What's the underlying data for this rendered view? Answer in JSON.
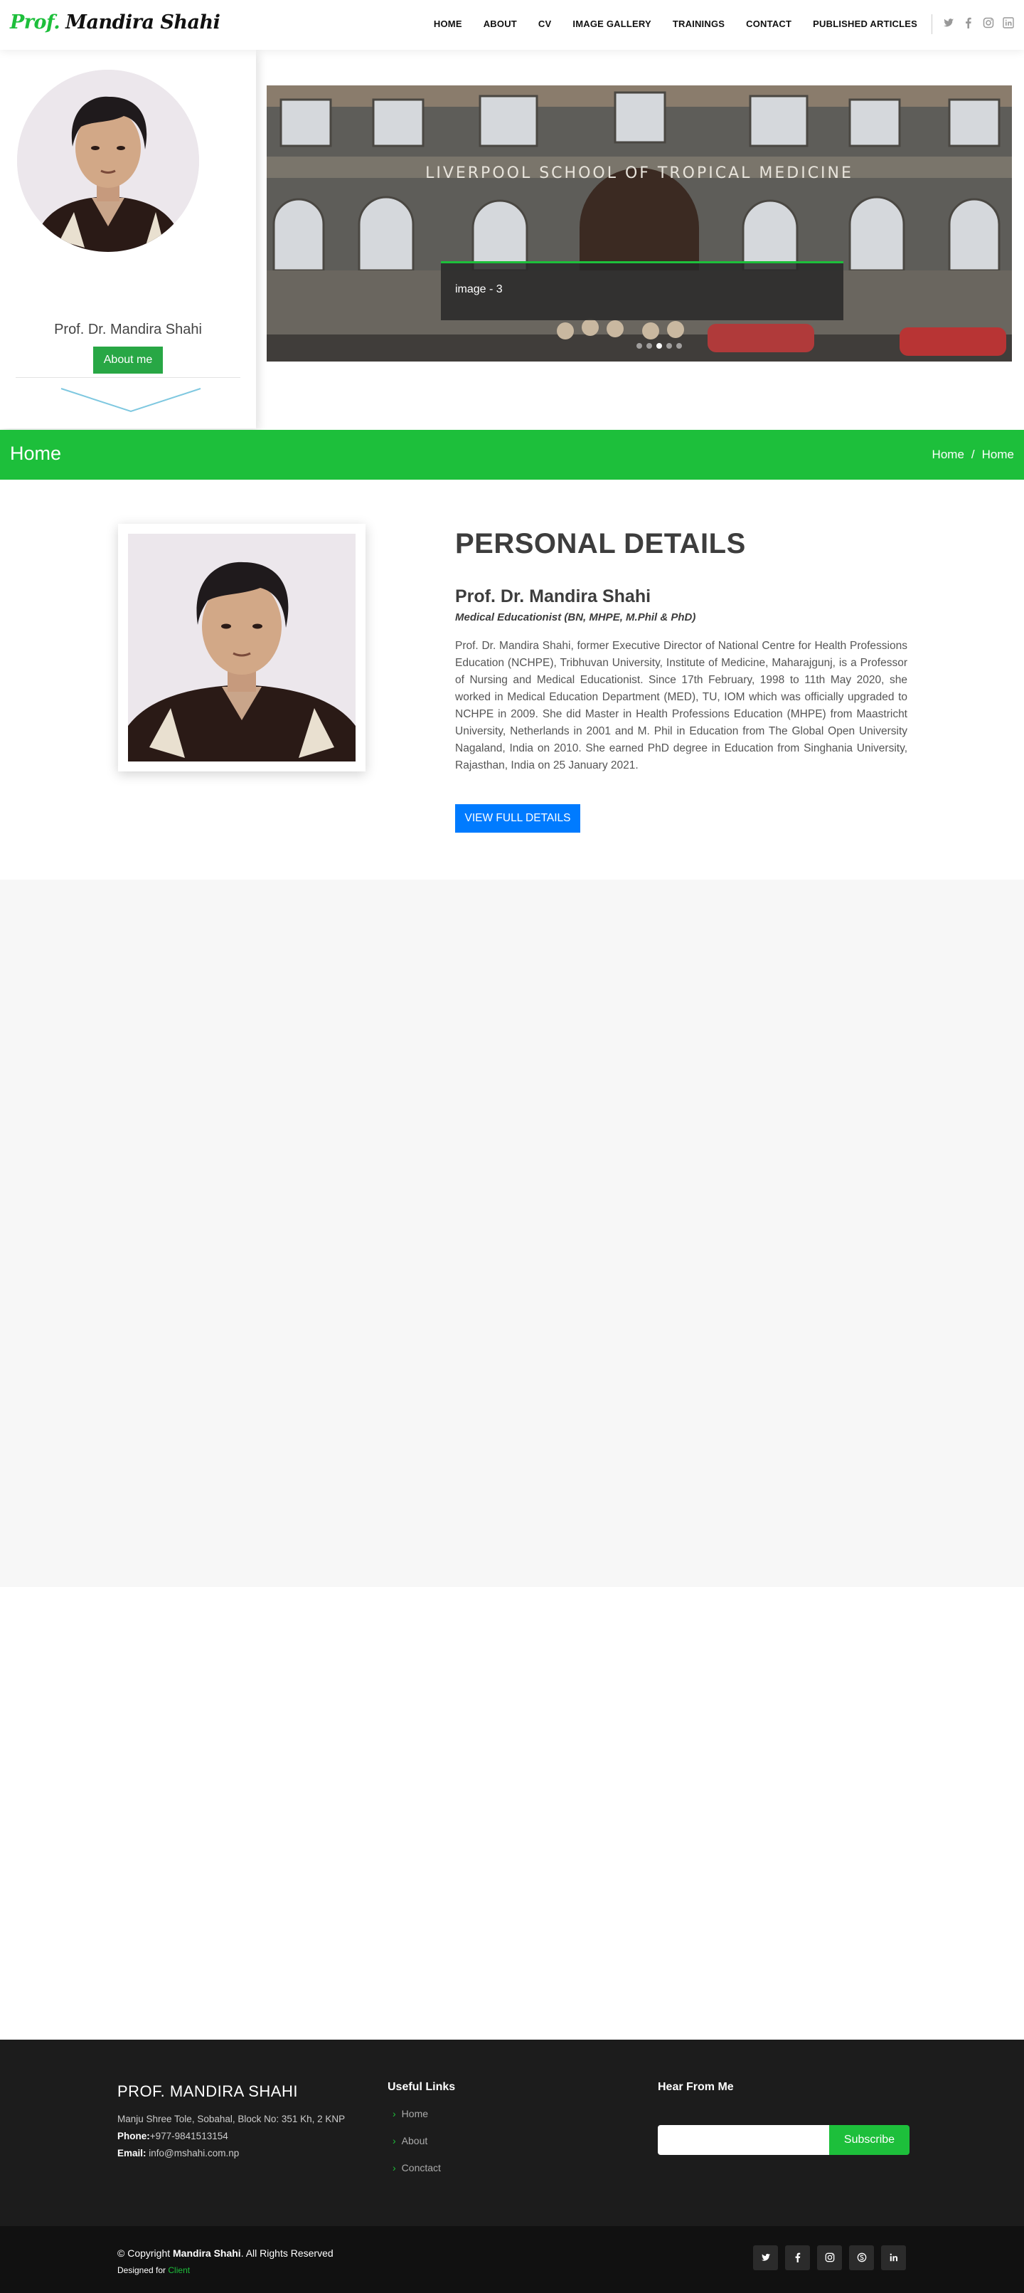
{
  "header": {
    "logo_prefix": "Prof.",
    "logo_name": "Mandira Shahi",
    "nav": [
      "HOME",
      "ABOUT",
      "CV",
      "IMAGE GALLERY",
      "TRAININGS",
      "CONTACT",
      "PUBLISHED ARTICLES"
    ],
    "social_icons": [
      "twitter-icon",
      "facebook-icon",
      "instagram-icon",
      "linkedin-icon"
    ]
  },
  "profile": {
    "name": "Prof. Dr. Mandira Shahi",
    "about_button": "About me"
  },
  "slider": {
    "building_sign": "LIVERPOOL   SCHOOL   OF          TROPICAL   MEDICINE",
    "caption": "image - 3",
    "slides_count": 5,
    "active_slide": 3
  },
  "page_bar": {
    "title": "Home",
    "breadcrumb": [
      "Home",
      "Home"
    ],
    "separator": "/",
    "color": "#1dbf3b"
  },
  "personal": {
    "heading": "PERSONAL DETAILS",
    "name": "Prof. Dr. Mandira Shahi",
    "role": "Medical  Educationist (BN, MHPE, M.Phil & PhD)",
    "bio": "Prof. Dr. Mandira Shahi, former Executive Director of National Centre for Health Professions Education (NCHPE), Tribhuvan University, Institute of Medicine, Maharajgunj, is a Professor of Nursing and Medical  Educationist.  Since 17th February, 1998 to 11th May 2020, she worked in Medical Education Department (MED), TU, IOM which was officially upgraded to NCHPE in 2009. She did Master in Health Professions Education (MHPE) from Maastricht University, Netherlands in 2001 and M. Phil in Education from The Global Open University Nagaland, India on 2010. She earned PhD degree in Education from Singhania University, Rajasthan, India on 25 January 2021.",
    "button": "VIEW FULL DETAILS"
  },
  "footer": {
    "brand": "PROF. MANDIRA SHAHI",
    "address": "Manju Shree Tole, Sobahal, Block No: 351 Kh, 2 KNP",
    "phone_label": "Phone:",
    "phone": "+977-9841513154",
    "email_label": "Email:",
    "email": "info@mshahi.com.np",
    "links_title": "Useful Links",
    "links": [
      "Home",
      "About",
      "Conctact"
    ],
    "hear_title": "Hear From Me",
    "subscribe": "Subscribe",
    "copyright_pre": "© Copyright",
    "copyright_name": "Mandira Shahi",
    "copyright_post": ". All Rights Reserved",
    "designed_pre": "Designed for",
    "designed_client": "Client",
    "social_icons": [
      "twitter-icon",
      "facebook-icon",
      "instagram-icon",
      "skype-icon",
      "linkedin-icon"
    ]
  }
}
